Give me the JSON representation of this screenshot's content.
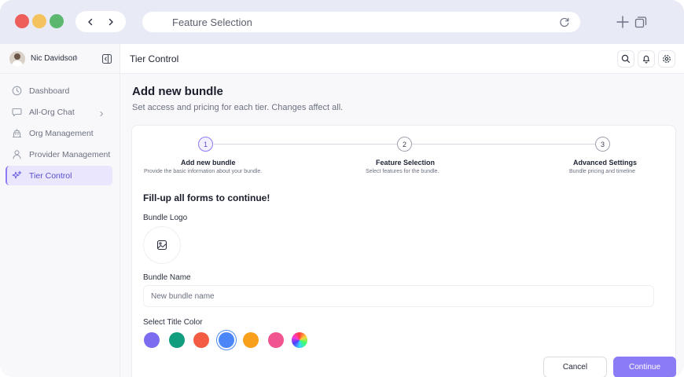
{
  "browser": {
    "url_text": "Feature Selection",
    "traffic_lights": {
      "close": "#ee5f5b",
      "minimize": "#f5c35e",
      "maximize": "#5bb86e"
    }
  },
  "sidebar": {
    "user_name": "Nic Davidson",
    "items": [
      {
        "label": "Dashboard",
        "icon": "dashboard-icon"
      },
      {
        "label": "All-Org Chat",
        "icon": "chat-icon",
        "has_submenu": true
      },
      {
        "label": "Org Management",
        "icon": "building-icon"
      },
      {
        "label": "Provider Management",
        "icon": "user-icon"
      },
      {
        "label": "Tier Control",
        "icon": "sparkle-icon",
        "active": true
      }
    ]
  },
  "topbar": {
    "title": "Tier Control",
    "actions": [
      "search-icon",
      "bell-icon",
      "settings-icon"
    ]
  },
  "page": {
    "title": "Add new bundle",
    "subtitle": "Set access and pricing for each tier. Changes affect all."
  },
  "stepper": {
    "active_step": 1,
    "steps": [
      {
        "number": "1",
        "title": "Add new bundle",
        "description": "Provide the basic information about your bundle."
      },
      {
        "number": "2",
        "title": "Feature Selection",
        "description": "Select features for the bundle."
      },
      {
        "number": "3",
        "title": "Advanced Settings",
        "description": "Bundle pricing and timeline"
      }
    ]
  },
  "form": {
    "heading": "Fill-up all forms to continue!",
    "logo_label": "Bundle Logo",
    "name_label": "Bundle Name",
    "name_placeholder": "New bundle name",
    "name_value": "",
    "color_label": "Select Title Color",
    "colors": [
      "#7b6cf0",
      "#129e7e",
      "#f35b45",
      "#4a86f7",
      "#f8a01c",
      "#f05591",
      "rainbow"
    ],
    "selected_color": "#4a86f7"
  },
  "actions": {
    "cancel_label": "Cancel",
    "continue_label": "Continue",
    "accent": "#8b7cf6"
  }
}
